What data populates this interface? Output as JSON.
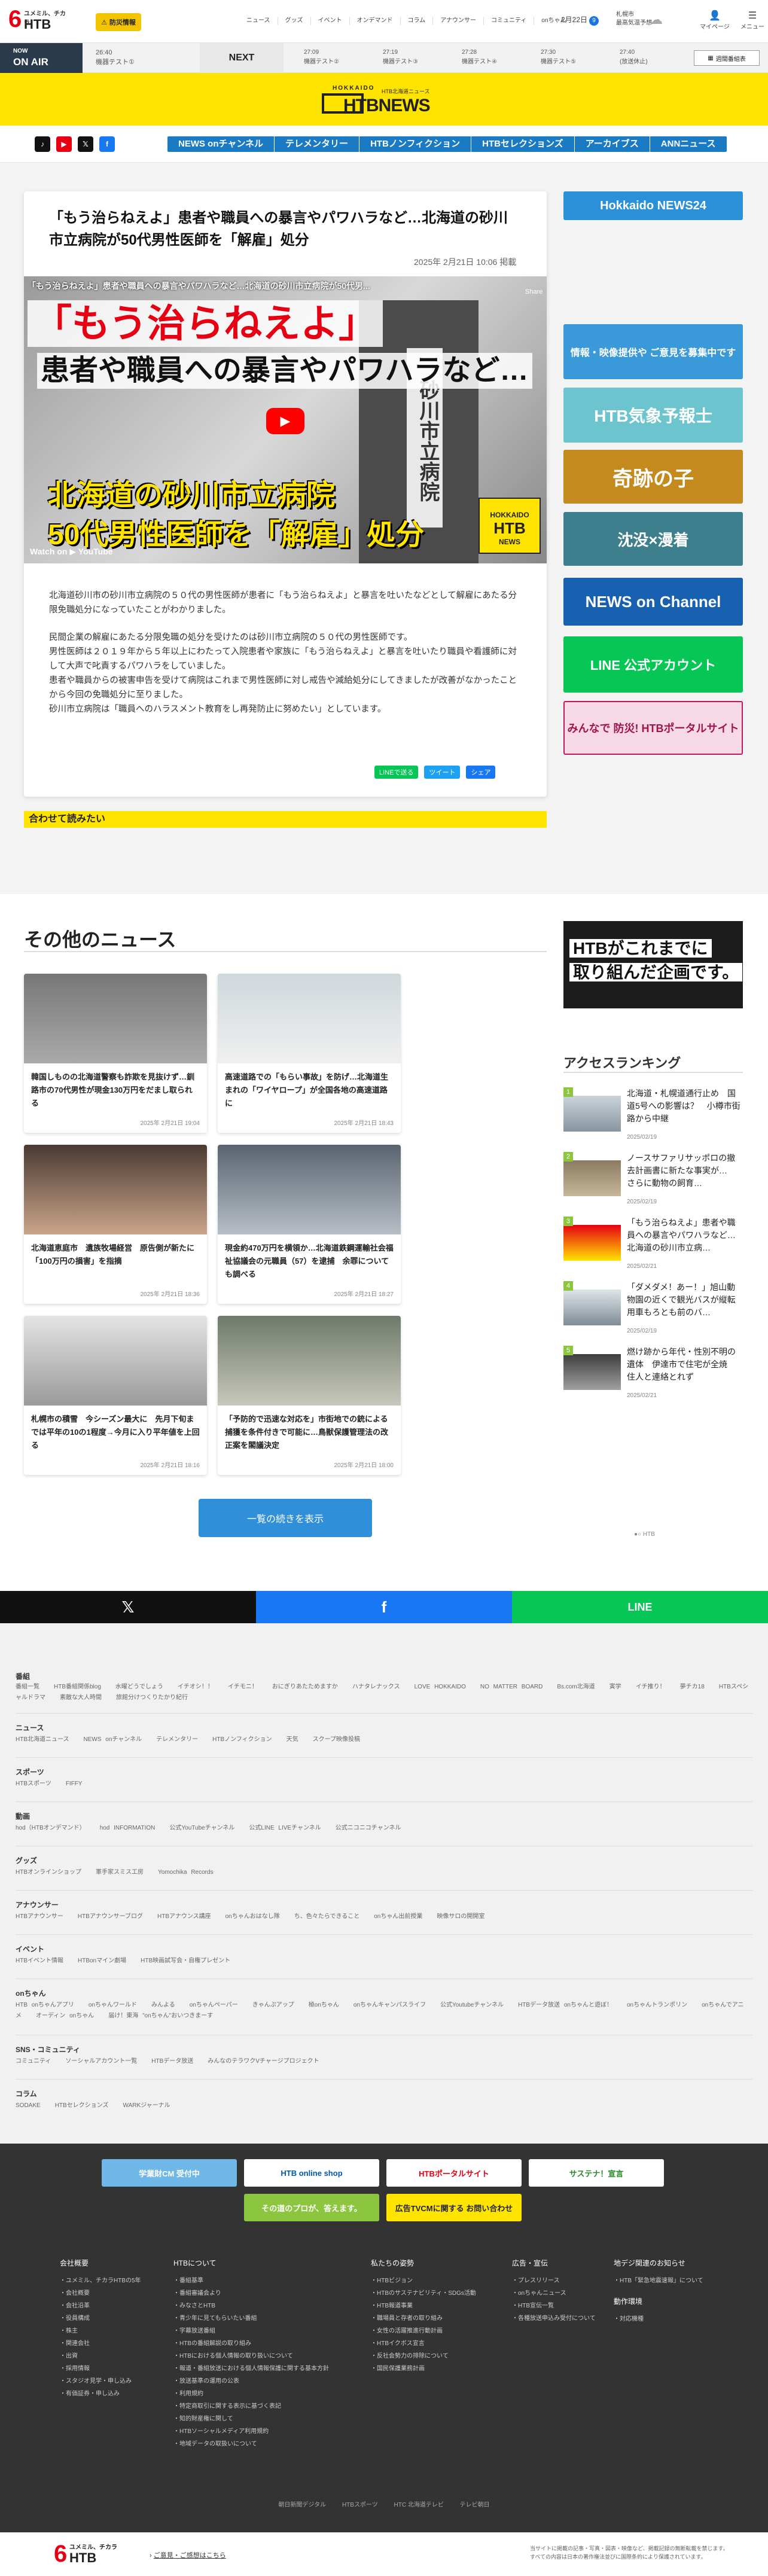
{
  "header": {
    "logo_main": "6",
    "logo_sub": "ユメミル、チカラ",
    "logo_htb": "HTB",
    "bousai": "防災情報",
    "nav": [
      "ニュース",
      "グッズ",
      "イベント",
      "オンデマンド",
      "コラム",
      "アナウンサー",
      "コミュニティ",
      "onちゃん"
    ],
    "date": "2月22日",
    "date_count": "9",
    "weather_city": "札幌市",
    "weather_label": "最高気温予想",
    "mypage": "マイページ",
    "menu": "メニュー"
  },
  "onair": {
    "now": "NOW",
    "on_air": "ON AIR",
    "current_time": "26:40",
    "current_title": "機器テスト①",
    "next_label": "NEXT",
    "next_items": [
      {
        "time": "27:09",
        "title": "機器テスト②"
      },
      {
        "time": "27:19",
        "title": "機器テスト③"
      },
      {
        "time": "27:28",
        "title": "機器テスト④"
      },
      {
        "time": "27:30",
        "title": "機器テスト⑤"
      },
      {
        "time": "27:40",
        "title": "(放送休止)"
      }
    ],
    "guide_button": "週間番組表"
  },
  "brand": {
    "hokkaido": "HOKKAIDO",
    "sub": "HTB北海道ニュース",
    "name": "HTBNEWS"
  },
  "subnav": {
    "items": [
      "NEWS onチャンネル",
      "テレメンタリー",
      "HTBノンフィクション",
      "HTBセレクションズ",
      "アーカイブス",
      "ANNニュース"
    ]
  },
  "article": {
    "title": "「もう治らねえよ」患者や職員への暴言やパワハラなど…北海道の砂川市立病院が50代男性医師を「解雇」処分",
    "date": "2025年 2月21日 10:06 掲載",
    "video": {
      "top_caption": "「もう治らねえよ」患者や職員への暴言やパワハラなど…北海道の砂川市立病院が50代男...",
      "caption1": "「もう治らねえよ」",
      "caption2": "患者や職員への暴言やパワハラなど…",
      "caption3": "北海道の砂川市立病院",
      "caption4": "50代男性医師を「解雇」処分",
      "sign": "砂川市立病院",
      "watch_on": "Watch on ▶ YouTube",
      "logo_top": "HOKKAIDO",
      "logo_main": "HTB",
      "logo_sub": "NEWS",
      "share": "Share"
    },
    "paragraphs": [
      "北海道砂川市の砂川市立病院の５０代の男性医師が患者に「もう治らねえよ」と暴言を吐いたなどとして解雇にあたる分限免職処分になっていたことがわかりました。",
      "民間企業の解雇にあたる分限免職の処分を受けたのは砂川市立病院の５０代の男性医師です。\n男性医師は２０１９年から５年以上にわたって入院患者や家族に「もう治らねえよ」と暴言を吐いたり職員や看護師に対して大声で叱責するパワハラをしていました。\n患者や職員からの被害申告を受けて病院はこれまで男性医師に対し戒告や減給処分にしてきましたが改善がなかったことから今回の免職処分に至りました。\n砂川市立病院は「職員へのハラスメント教育をし再発防止に努めたい」としています。"
    ],
    "share": [
      "LINEで送る",
      "ツイート",
      "シェア"
    ]
  },
  "related_title": "合わせて読みたい",
  "sidebar_banners": [
    {
      "text": "Hokkaido NEWS24"
    },
    {
      "text": "情報・映像提供や ご意見を募集中です"
    },
    {
      "text": "HTB気象予報士"
    },
    {
      "text": "奇跡の子"
    },
    {
      "text": "沈没×漫着"
    },
    {
      "text": "NEWS on Channel"
    },
    {
      "text": "LINE 公式アカウント"
    },
    {
      "text": "みんなで 防災! HTBポータルサイト"
    }
  ],
  "other_news": {
    "title": "その他のニュース",
    "cards": [
      {
        "title": "韓国しものの北海道警察も詐欺を見抜けず…釧路市の70代男性が現金130万円をだまし取られる",
        "date": "2025年 2月21日 19:04"
      },
      {
        "title": "高速道路での「もらい事故」を防げ…北海道生まれの「ワイヤロープ」が全国各地の高速道路に",
        "date": "2025年 2月21日 18:43"
      },
      {
        "title": "北海道恵庭市　遺族牧場経営　原告側が新たに「100万円の損害」を指摘",
        "date": "2025年 2月21日 18:36"
      },
      {
        "title": "現金約470万円を横領か…北海道鉄鋼運輸社会福祉協議会の元職員（57）を逮捕　余罪についても調べる",
        "date": "2025年 2月21日 18:27"
      },
      {
        "title": "札幌市の積雪　今シーズン最大に　先月下旬までは平年の10の1程度→今月に入り平年値を上回る",
        "date": "2025年 2月21日 18:16"
      },
      {
        "title": "「予防的で迅速な対応を」市街地での銃による捕獲を条件付きで可能に…鳥獣保護管理法の改正案を閣議決定",
        "date": "2025年 2月21日 18:00"
      }
    ],
    "more_button": "一覧の続きを表示"
  },
  "promo": {
    "line1": "HTBがこれまでに",
    "line2": "取り組んだ企画です。"
  },
  "ranking": {
    "title": "アクセスランキング",
    "items": [
      {
        "n": "1",
        "title": "北海道・札幌道通行止め　国道5号への影響は？　小樽市街路から中継",
        "date": "2025/02/19"
      },
      {
        "n": "2",
        "title": "ノースサファリサッポロの撤去計画書に新たな事実が…　さらに動物の飼育…",
        "date": "2025/02/19"
      },
      {
        "n": "3",
        "title": "「もう治らねえよ」患者や職員への暴言やパワハラなど…北海道の砂川市立病…",
        "date": "2025/02/21"
      },
      {
        "n": "4",
        "title": "「ダメダメ！あー！」旭山動物園の近くで観光バスが縦転用車もろとも前のバ…",
        "date": "2025/02/19"
      },
      {
        "n": "5",
        "title": "燃け跡から年代・性別不明の遺体　伊達市で住宅が全焼　住人と連絡とれず",
        "date": "2025/02/21"
      }
    ],
    "dots": "●○ HTB"
  },
  "sharebar": [
    "𝕏",
    "f",
    "LINE"
  ],
  "sitemap": [
    {
      "cat": "番組",
      "items": [
        "番組一覧",
        "HTB番組関係blog",
        "水曜どうでしょう",
        "イチオシ！！",
        "イチモニ！",
        "おにぎりあたためますか",
        "ハナタレナックス",
        "LOVE HOKKAIDO",
        "NO MATTER BOARD",
        "Bs.com北海道",
        "寅学",
        "イチ推り！",
        "夢チカ18",
        "HTBスペシャルドラマ",
        "素敵な大人時間",
        "旅館分けつくりたかり紀行"
      ]
    },
    {
      "cat": "ニュース",
      "items": [
        "HTB北海道ニュース",
        "NEWS onチャンネル",
        "テレメンタリー",
        "HTBノンフィクション",
        "天気",
        "スクープ映像投稿"
      ]
    },
    {
      "cat": "スポーツ",
      "items": [
        "HTBスポーツ",
        "FIFFY"
      ]
    },
    {
      "cat": "動画",
      "items": [
        "hod（HTBオンデマンド）",
        "hod INFORMATION",
        "公式YouTubeチャンネル",
        "公式LINE LIVEチャンネル",
        "公式ニコニコチャンネル"
      ]
    },
    {
      "cat": "グッズ",
      "items": [
        "HTBオンラインショップ",
        "軍手家スミス工房",
        "Yomochika Records"
      ]
    },
    {
      "cat": "アナウンサー",
      "items": [
        "HTBアナウンサー",
        "HTBアナウンサーブログ",
        "HTBアナウンス講座",
        "onちゃんおはなし隊",
        "ち、色々たらできること",
        "onちゃん出前授業",
        "映像サロの開開室"
      ]
    },
    {
      "cat": "イベント",
      "items": [
        "HTBイベント情報",
        "HTBonマイン劇場",
        "HTB映画試写会・自権プレゼント"
      ]
    },
    {
      "cat": "onちゃん",
      "items": [
        "HTB onちゃんアプリ",
        "onちゃんワールド",
        "みんよる",
        "onちゃんペーパー",
        "きゃんぷアップ",
        "極onちゃん",
        "onちゃんキャンパスライフ",
        "公式Youtubeチャンネル",
        "HTBデータ放送 onちゃんと遊ぼ！",
        "onちゃんトランポリン",
        "onちゃんでアニメ",
        "オーディン onちゃん",
        "届け！東海 \"onちゃん\"おいつきまーす"
      ]
    },
    {
      "cat": "SNS・コミュニティ",
      "items": [
        "コミュニティ",
        "ソーシャルアカウント一覧",
        "HTBデータ放送",
        "みんなのテラワクVチャージプロジェクト"
      ]
    },
    {
      "cat": "コラム",
      "items": [
        "SODAKE",
        "HTBセレクションズ",
        "WARKジャーナル"
      ]
    }
  ],
  "footer": {
    "banners": [
      "学業財CM 受付中",
      "HTB online shop",
      "HTBポータルサイト",
      "サステナ！宣言",
      "その道のプロが、答えます。",
      "広告TVCMに関する お問い合わせ"
    ],
    "columns": [
      {
        "title": "会社概要",
        "items": [
          "ユメミル、チカラHTBの5年",
          "会社概要",
          "会社沿革",
          "役員構成",
          "株主",
          "関連会社",
          "出資",
          "採用情報",
          "スタジオ見学・申し込み",
          "有価証券・申し込み"
        ]
      },
      {
        "title": "HTBについて",
        "items": [
          "番組基準",
          "番組審議会より",
          "みなさとHTB",
          "青少年に見てもらいたい番組",
          "字幕放送番組",
          "HTBの番組解説の取り組み",
          "HTBにおける個人情報の取り扱いについて",
          "報道・番組放送における個人情報保護に関する基本方針",
          "放送基準の運用の公表",
          "利用規約",
          "特定商取引に関する表示に基づく表記",
          "知的財産権に関して",
          "HTBソーシャルメディア利用規約",
          "地域データの取扱いについて"
        ]
      },
      {
        "title": "私たちの姿勢",
        "items": [
          "HTBビジョン",
          "HTBのサステナビリティ・SDGs活動",
          "HTB報道事業",
          "職場員と存者の取り組み",
          "女性の活躍推進行動計画",
          "HTBイクボス宣言",
          "反社会勢力の排除について",
          "国民保護業務計画"
        ]
      },
      {
        "title": "広告・宣伝",
        "items": [
          "プレスリリース",
          "onちゃんニュース",
          "HTB宣伝一覧",
          "各種放送申込み受付について"
        ]
      },
      {
        "title": "地デジ関連のお知らせ",
        "items": [
          "HTB「緊急地震速報」について"
        ]
      },
      {
        "title": "動作環境",
        "items": [
          "対応機種"
        ]
      }
    ],
    "links": [
      "朝日新聞デジタル",
      "HTBスポーツ",
      "HTC 北海道テレビ",
      "テレビ朝日"
    ]
  },
  "bottombar": {
    "contact": "ご意見・ご感想はこちら",
    "copyright": "当サイトに掲載の記事・写真・図表・映像など、掲載記録の無断転載を禁じます。\nすべての内容は日本の著作権法並びに国際条約により保護されています。"
  },
  "colors": {
    "brand_yellow": "#ffe400",
    "accent_blue": "#1b7ac4",
    "red": "#e60012"
  }
}
